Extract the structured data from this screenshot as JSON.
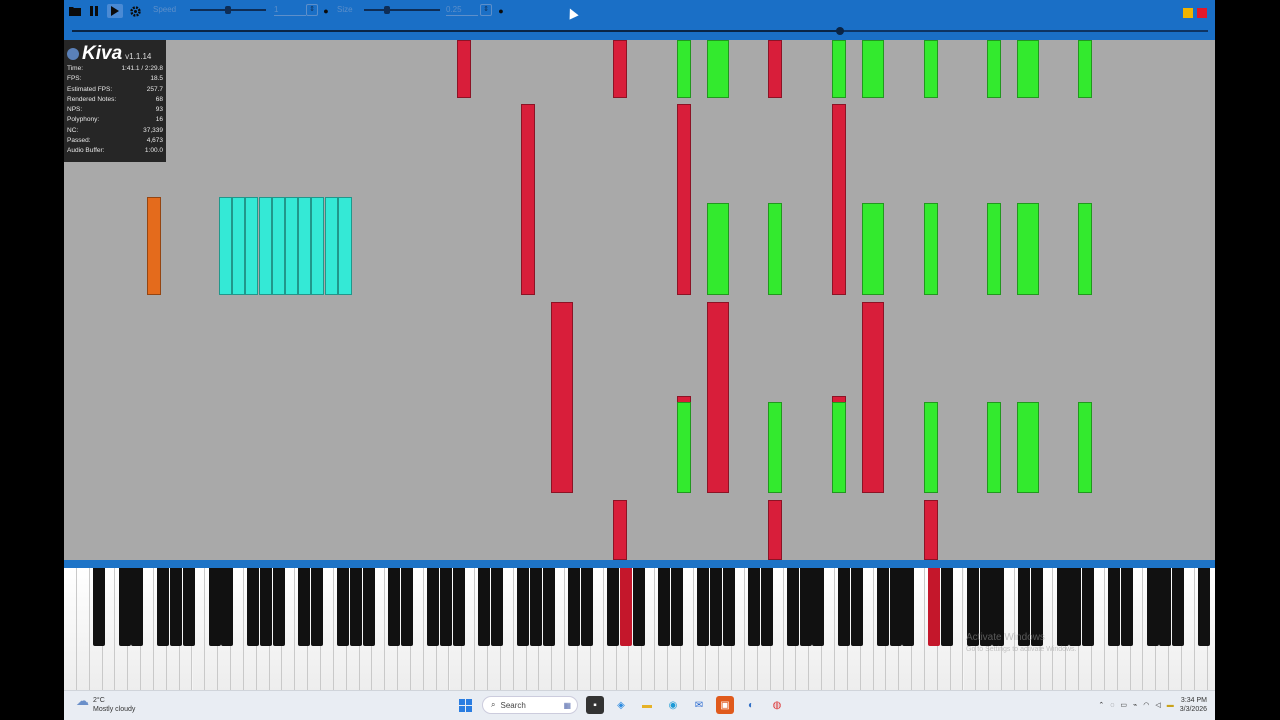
{
  "app": {
    "name": "Kiva",
    "version": "v1.1.14",
    "colors": {
      "toolbar": "#1a6fc6",
      "background": "#a9a9a9",
      "red": "#d81e3a",
      "green": "#33ea2e",
      "cyan": "#34e9d6",
      "orange": "#e46b1c"
    }
  },
  "toolbar": {
    "icons": [
      "folder-icon",
      "pause-icon",
      "play-icon",
      "gear-icon"
    ],
    "speed_label": "Speed",
    "speed_value": "1",
    "speed_level": 0.5,
    "size_label": "Size",
    "size_value": "0.25",
    "size_level": 0.3,
    "seek_progress": 0.676
  },
  "stats": {
    "rows": [
      {
        "label": "Time:",
        "value": "1:41.1 / 2:29.8"
      },
      {
        "label": "FPS:",
        "value": "18.5"
      },
      {
        "label": "Estimated FPS:",
        "value": "257.7"
      },
      {
        "label": "Rendered Notes:",
        "value": "68"
      },
      {
        "label": "NPS:",
        "value": "93"
      },
      {
        "label": "Polyphony:",
        "value": "16"
      },
      {
        "label": "NC:",
        "value": "37,339"
      },
      {
        "label": "Passed:",
        "value": "4,673"
      },
      {
        "label": "Audio Buffer:",
        "value": "1:00.0"
      }
    ]
  },
  "watermark": {
    "title": "Activate Windows",
    "subtitle": "Go to Settings to activate Windows."
  },
  "taskbar": {
    "weather_temp": "2°C",
    "weather_desc": "Mostly cloudy",
    "search_label": "Search",
    "time": "3:34 PM",
    "date": "3/3/2026"
  }
}
